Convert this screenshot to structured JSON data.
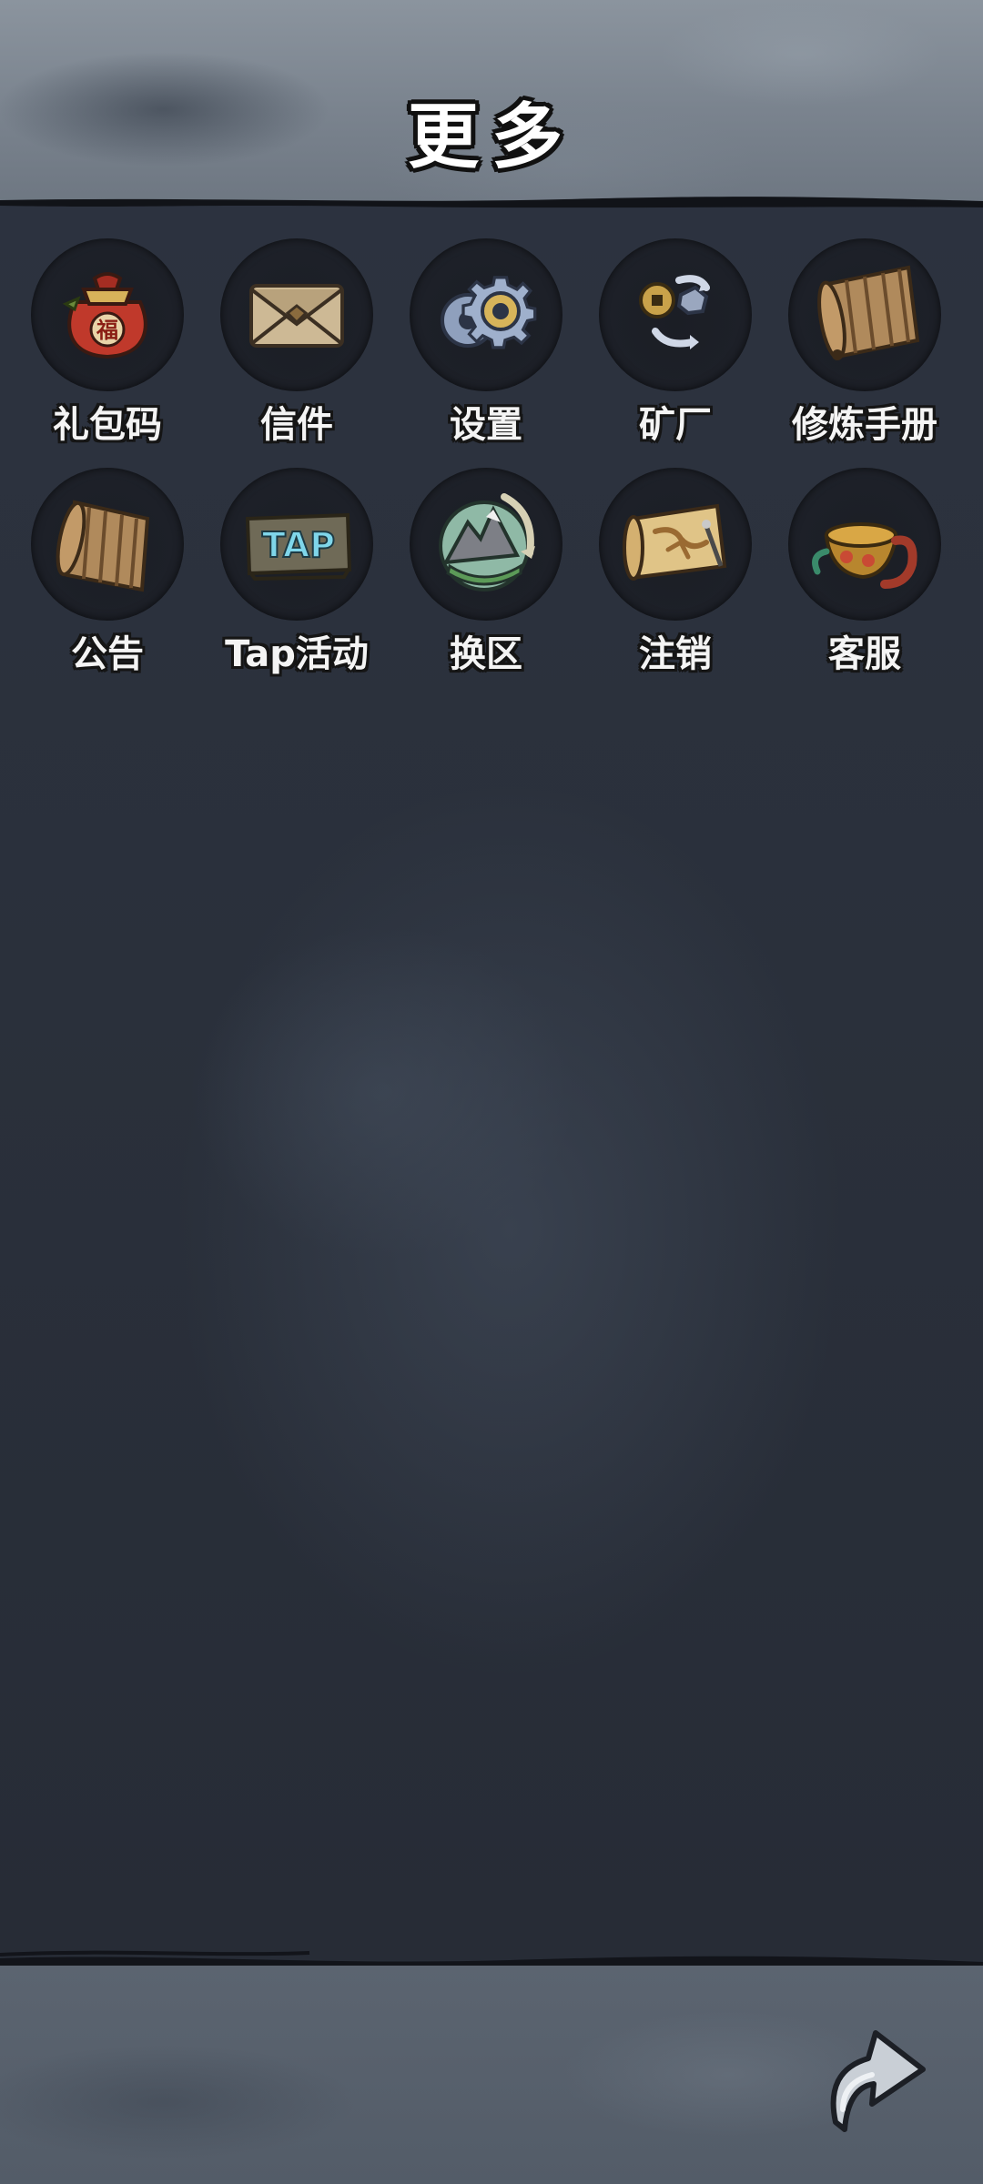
{
  "header": {
    "title": "更多"
  },
  "menu": {
    "items": [
      {
        "id": "gift-code",
        "label": "礼包码",
        "icon": "gift-bag-icon"
      },
      {
        "id": "mail",
        "label": "信件",
        "icon": "envelope-icon"
      },
      {
        "id": "settings",
        "label": "设置",
        "icon": "gear-icon"
      },
      {
        "id": "mine",
        "label": "矿厂",
        "icon": "ore-exchange-icon"
      },
      {
        "id": "handbook",
        "label": "修炼手册",
        "icon": "scroll-icon"
      },
      {
        "id": "notice",
        "label": "公告",
        "icon": "scroll-icon"
      },
      {
        "id": "tap-event",
        "label": "Tap活动",
        "icon": "tap-sign-icon",
        "sign_text": "TAP"
      },
      {
        "id": "switch-server",
        "label": "换区",
        "icon": "mountain-globe-icon"
      },
      {
        "id": "logout",
        "label": "注销",
        "icon": "map-scroll-icon"
      },
      {
        "id": "support",
        "label": "客服",
        "icon": "teapot-icon"
      }
    ]
  },
  "footer": {
    "back_icon": "return-arrow-icon"
  },
  "colors": {
    "background": "#2a2f3a",
    "header": "#7d8691",
    "icon_circle": "#1d2028",
    "label_text": "#f4f4f4"
  }
}
